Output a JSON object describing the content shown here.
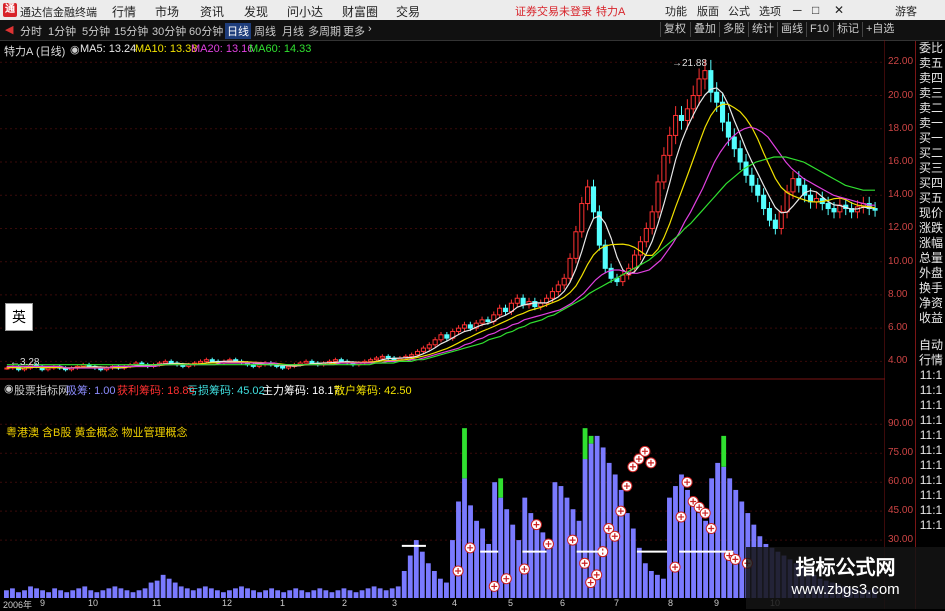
{
  "titlebar": {
    "app_name": "通达信金融终端",
    "menus": [
      "行情",
      "市场",
      "资讯",
      "发现",
      "问小达",
      "财富圈",
      "交易"
    ],
    "alert": "证券交易未登录",
    "stock": "特力A",
    "right": [
      "功能",
      "版面",
      "公式",
      "选项"
    ],
    "guest": "游客",
    "accent": "#d8232a"
  },
  "toolbar": {
    "periods": [
      "分时",
      "1分钟",
      "5分钟",
      "15分钟",
      "30分钟",
      "60分钟",
      "日线",
      "周线",
      "月线",
      "多周期",
      "更多"
    ],
    "active_period": "日线",
    "right_buttons": [
      "复权",
      "叠加",
      "多股",
      "统计",
      "画线",
      "F10",
      "标记",
      "+自选"
    ]
  },
  "header": {
    "stock_label": "特力A",
    "period_label": "(日线)",
    "ma5": "MA5: 13.24",
    "ma10": "MA10: 13.38",
    "ma20": "MA20: 13.16",
    "ma60": "MA60: 14.33"
  },
  "price_axis": [
    "22.00",
    "20.00",
    "18.00",
    "16.00",
    "14.00",
    "12.00",
    "10.00",
    "8.00",
    "6.00",
    "4.00"
  ],
  "high_label": "21.88",
  "low_label": "3.28",
  "ying_label": "英",
  "indicator": {
    "source": "股票指标网",
    "ratio": "吸筹: 1.00",
    "profit": "获利筹码: 18.89",
    "loss": "亏损筹码: 45.02",
    "main": "主力筹码: 18.17",
    "retail": "散户筹码: 42.50",
    "axis": [
      "90.00",
      "75.00",
      "60.00",
      "45.00",
      "30.00"
    ]
  },
  "concepts": "粤港澳 含B股 黄金概念 物业管理概念",
  "right_panel": {
    "top_items": [
      "委比",
      "卖五",
      "卖四",
      "卖三",
      "卖二",
      "卖一",
      "买一",
      "买二",
      "买三",
      "买四",
      "买五",
      "现价",
      "涨跌",
      "涨幅",
      "总量",
      "外盘",
      "换手",
      "净资",
      "收益"
    ],
    "bottom_items": [
      "自动",
      "行情",
      "11:1",
      "11:1",
      "11:1",
      "11:1",
      "11:1",
      "11:1",
      "11:1",
      "11:1",
      "11:1",
      "11:1",
      "11:1"
    ]
  },
  "x_axis": [
    "2006年",
    "9",
    "10",
    "11",
    "12",
    "1",
    "2",
    "3",
    "4",
    "5",
    "6",
    "7",
    "8",
    "9",
    "10"
  ],
  "watermark": {
    "title": "指标公式网",
    "url": "www.zbgs3.com"
  },
  "chart_data": {
    "type": "candlestick",
    "price_range": [
      3.0,
      22.5
    ],
    "candles_close": [
      3.6,
      3.7,
      3.5,
      3.6,
      3.8,
      3.7,
      3.5,
      3.6,
      3.7,
      3.6,
      3.5,
      3.6,
      3.7,
      3.8,
      3.7,
      3.6,
      3.5,
      3.6,
      3.7,
      3.6,
      3.7,
      3.8,
      3.9,
      3.8,
      3.7,
      3.8,
      3.9,
      4.0,
      3.9,
      3.8,
      3.7,
      3.8,
      3.9,
      4.0,
      4.1,
      4.0,
      3.9,
      4.0,
      4.1,
      4.0,
      3.9,
      3.8,
      3.7,
      3.8,
      3.9,
      3.8,
      3.7,
      3.6,
      3.7,
      3.8,
      3.9,
      4.0,
      3.9,
      3.8,
      3.9,
      4.0,
      4.1,
      4.0,
      3.9,
      3.8,
      3.9,
      4.0,
      4.1,
      4.2,
      4.3,
      4.2,
      4.1,
      4.2,
      4.3,
      4.4,
      4.6,
      4.8,
      5.0,
      5.3,
      5.6,
      5.4,
      5.8,
      6.0,
      6.2,
      6.0,
      6.3,
      6.5,
      6.4,
      6.8,
      7.2,
      7.0,
      7.5,
      7.8,
      7.4,
      7.6,
      7.3,
      7.5,
      7.8,
      8.2,
      8.6,
      9.0,
      10.2,
      11.8,
      13.5,
      14.5,
      13.0,
      11.0,
      9.6,
      9.0,
      8.8,
      9.2,
      9.6,
      10.4,
      11.2,
      12.0,
      13.0,
      14.8,
      16.4,
      17.6,
      18.8,
      18.5,
      19.2,
      20.0,
      21.0,
      21.5,
      20.2,
      19.6,
      18.4,
      17.5,
      16.8,
      16.0,
      15.2,
      14.6,
      14.0,
      13.2,
      12.5,
      12.0,
      13.0,
      14.2,
      15.0,
      14.6,
      14.0,
      13.6,
      13.8,
      13.5,
      13.2,
      13.0,
      13.4,
      13.2,
      13.0,
      13.3,
      13.5,
      13.2,
      13.1
    ],
    "ma20": [
      3.7,
      3.7,
      3.7,
      3.7,
      3.7,
      3.7,
      3.7,
      3.7,
      3.7,
      3.7,
      3.6,
      3.6,
      3.6,
      3.6,
      3.6,
      3.6,
      3.6,
      3.6,
      3.7,
      3.7,
      3.7,
      3.7,
      3.7,
      3.7,
      3.7,
      3.7,
      3.8,
      3.8,
      3.8,
      3.8,
      3.8,
      3.8,
      3.8,
      3.8,
      3.8,
      3.8,
      3.9,
      3.9,
      3.9,
      3.9,
      3.9,
      3.9,
      3.9,
      3.9,
      3.9,
      3.9,
      3.8,
      3.8,
      3.8,
      3.8,
      3.8,
      3.8,
      3.8,
      3.8,
      3.8,
      3.8,
      3.9,
      3.9,
      3.9,
      3.9,
      3.9,
      3.9,
      3.9,
      3.9,
      4.0,
      4.0,
      4.0,
      4.0,
      4.1,
      4.1,
      4.2,
      4.3,
      4.4,
      4.5,
      4.6,
      4.7,
      4.8,
      5.0,
      5.1,
      5.3,
      5.4,
      5.6,
      5.7,
      5.9,
      6.0,
      6.2,
      6.3,
      6.5,
      6.6,
      6.7,
      6.8,
      6.9,
      7.0,
      7.1,
      7.3,
      7.5,
      7.8,
      8.1,
      8.5,
      8.9,
      9.2,
      9.4,
      9.5,
      9.5,
      9.4,
      9.3,
      9.3,
      9.4,
      9.5,
      9.8,
      10.1,
      10.6,
      11.1,
      11.7,
      12.4,
      13.0,
      13.7,
      14.4,
      15.2,
      16.0,
      16.6,
      17.1,
      17.5,
      17.8,
      18.0,
      18.1,
      18.0,
      17.8,
      17.5,
      17.0,
      16.5,
      16.0,
      15.6,
      15.3,
      15.0,
      14.8,
      14.6,
      14.4,
      14.2,
      14.0,
      13.9,
      13.8,
      13.7,
      13.6,
      13.5,
      13.4,
      13.4
    ],
    "ma60": [
      3.8,
      3.8,
      3.8,
      3.8,
      3.8,
      3.8,
      3.8,
      3.8,
      3.8,
      3.8,
      3.8,
      3.8,
      3.8,
      3.8,
      3.8,
      3.8,
      3.8,
      3.8,
      3.8,
      3.8,
      3.8,
      3.8,
      3.8,
      3.8,
      3.8,
      3.8,
      3.8,
      3.8,
      3.8,
      3.8,
      3.8,
      3.8,
      3.8,
      3.8,
      3.8,
      3.8,
      3.8,
      3.8,
      3.8,
      3.8,
      3.8,
      3.8,
      3.8,
      3.8,
      3.8,
      3.8,
      3.8,
      3.8,
      3.8,
      3.8,
      3.8,
      3.8,
      3.8,
      3.8,
      3.8,
      3.8,
      3.8,
      3.8,
      3.8,
      3.8,
      3.8,
      3.8,
      3.9,
      3.9,
      3.9,
      3.9,
      4.0,
      4.0,
      4.0,
      4.1,
      4.1,
      4.2,
      4.3,
      4.4,
      4.5,
      4.6,
      4.7,
      4.8,
      4.9,
      5.0,
      5.1,
      5.3,
      5.4,
      5.5,
      5.7,
      5.8,
      6.0,
      6.1,
      6.3,
      6.4,
      6.5,
      6.7,
      6.8,
      7.0,
      7.2,
      7.4,
      7.6,
      7.8,
      8.1,
      8.3,
      8.5,
      8.7,
      8.9,
      9.1,
      9.3,
      9.5,
      9.7,
      9.9,
      10.1,
      10.4,
      10.7,
      11.0,
      11.3,
      11.6,
      12.0,
      12.3,
      12.7,
      13.1,
      13.5,
      13.9,
      14.3,
      14.7,
      15.0,
      15.3,
      15.6,
      15.8,
      16.0,
      16.1,
      16.2,
      16.3,
      16.3,
      16.3,
      16.2,
      16.1,
      16.0,
      15.8,
      15.6,
      15.4,
      15.2,
      15.0,
      14.8,
      14.6,
      14.5,
      14.4,
      14.3,
      14.3,
      14.3
    ],
    "indicator_range": [
      0,
      100
    ],
    "bars": [
      4,
      5,
      3,
      4,
      6,
      5,
      4,
      3,
      5,
      4,
      3,
      4,
      5,
      6,
      4,
      3,
      4,
      5,
      6,
      5,
      4,
      3,
      4,
      5,
      8,
      9,
      12,
      10,
      8,
      6,
      5,
      4,
      5,
      6,
      5,
      4,
      3,
      4,
      5,
      6,
      5,
      4,
      3,
      4,
      5,
      4,
      3,
      4,
      5,
      4,
      3,
      4,
      5,
      4,
      3,
      4,
      5,
      4,
      3,
      4,
      5,
      6,
      5,
      4,
      5,
      6,
      14,
      22,
      30,
      24,
      18,
      14,
      10,
      8,
      30,
      50,
      62,
      48,
      40,
      36,
      28,
      60,
      52,
      46,
      38,
      30,
      52,
      44,
      40,
      34,
      28,
      60,
      58,
      52,
      46,
      40,
      72,
      80,
      84,
      78,
      70,
      64,
      56,
      44,
      36,
      26,
      18,
      14,
      12,
      10,
      52,
      58,
      64,
      56,
      48,
      44,
      40,
      62,
      70,
      68,
      62,
      56,
      50,
      44,
      38,
      32,
      28,
      26,
      24,
      22,
      20,
      18,
      16,
      14,
      12,
      10,
      9,
      8,
      7,
      6,
      5,
      5,
      4,
      4,
      5
    ],
    "green_spikes": [
      [
        76,
        88
      ],
      [
        82,
        62
      ],
      [
        96,
        88
      ],
      [
        97,
        84
      ],
      [
        119,
        84
      ]
    ]
  }
}
